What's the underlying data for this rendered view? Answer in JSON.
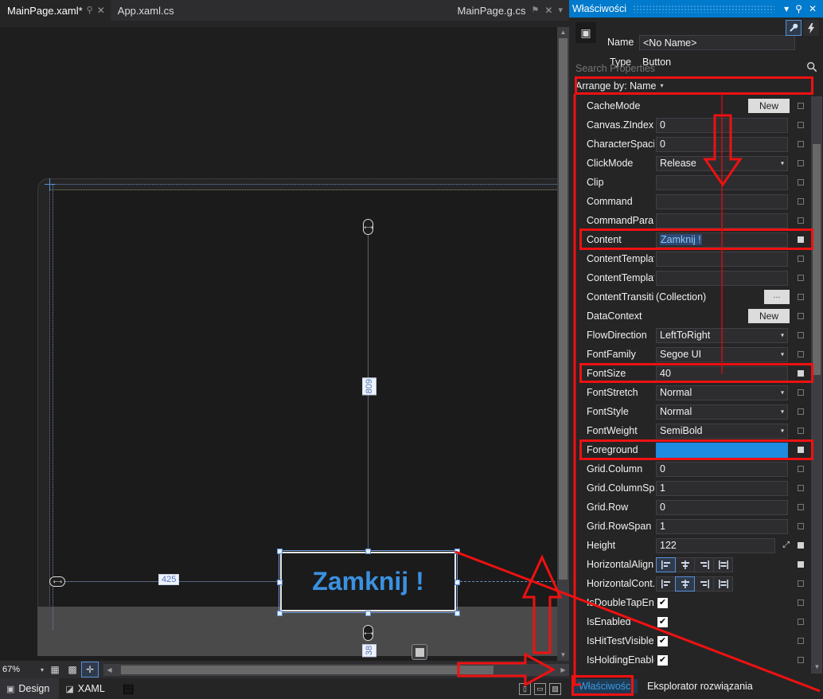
{
  "editor": {
    "tabs": [
      {
        "label": "MainPage.xaml*",
        "active": true,
        "pin": "⚲",
        "close": "✕"
      },
      {
        "label": "App.xaml.cs",
        "active": false,
        "pin": "",
        "close": ""
      }
    ],
    "right_tab": {
      "label": "MainPage.g.cs",
      "pin": "⚑",
      "close": "✕",
      "menu": "▾"
    }
  },
  "designer": {
    "button_text": "Zamknij !",
    "width_measure": "425",
    "height_measure": "809",
    "button_height_measure": "38",
    "measure_cap_glyph": "⟷",
    "zoom_level": "67%",
    "zoom_caret": "▾",
    "toolbar_icons": [
      {
        "name": "grid-icon",
        "glyph": "▦",
        "selected": false
      },
      {
        "name": "snap-grid-icon",
        "glyph": "▩",
        "selected": false
      },
      {
        "name": "snap-to-guides-icon",
        "glyph": "✛",
        "selected": true
      }
    ],
    "scroll_left_arrow": "◀",
    "scroll_right_arrow": "▶",
    "scroll_up_arrow": "▲",
    "scroll_down_arrow": "▼"
  },
  "designer_footer": {
    "tabs": [
      {
        "label": "Design",
        "icon": "▣",
        "active": true
      },
      {
        "label": "XAML",
        "icon": "◪",
        "active": false
      }
    ],
    "extra_icon": "▤",
    "split_buttons": [
      {
        "name": "vertical-split-button",
        "glyph": "▯"
      },
      {
        "name": "horizontal-split-button",
        "glyph": "▭"
      },
      {
        "name": "design-view-button",
        "glyph": "▨"
      }
    ]
  },
  "properties": {
    "title": "Właściwości",
    "title_controls": {
      "menu": "▾",
      "pin": "⚲",
      "close": "✕"
    },
    "object_icon": "▣",
    "name_label": "Name",
    "name_value": "<No Name>",
    "type_label": "Type",
    "type_value": "Button",
    "wrench_icon": "🔧",
    "events_icon": "⚡",
    "search_placeholder": "Search Properties",
    "search_icon": "🔍",
    "arrange_by": "Arrange by: Name",
    "rows": [
      {
        "name": "CacheMode",
        "kind": "new",
        "value": "",
        "marker": "empty"
      },
      {
        "name": "Canvas.ZIndex",
        "kind": "text",
        "value": "0",
        "marker": "empty"
      },
      {
        "name": "CharacterSpacing",
        "kind": "text",
        "value": "0",
        "marker": "empty"
      },
      {
        "name": "ClickMode",
        "kind": "dropdown",
        "value": "Release",
        "marker": "empty"
      },
      {
        "name": "Clip",
        "kind": "text",
        "value": "",
        "marker": "empty"
      },
      {
        "name": "Command",
        "kind": "text",
        "value": "",
        "marker": "empty"
      },
      {
        "name": "CommandPara...",
        "kind": "text",
        "value": "",
        "marker": "empty"
      },
      {
        "name": "Content",
        "kind": "selected-text",
        "value": "Zamknij !",
        "marker": "filled"
      },
      {
        "name": "ContentTemplate",
        "kind": "text",
        "value": "",
        "marker": "empty"
      },
      {
        "name": "ContentTemplat...",
        "kind": "text",
        "value": "",
        "marker": "empty"
      },
      {
        "name": "ContentTransiti...",
        "kind": "collection",
        "value": "(Collection)",
        "marker": "empty"
      },
      {
        "name": "DataContext",
        "kind": "new",
        "value": "",
        "marker": "empty"
      },
      {
        "name": "FlowDirection",
        "kind": "dropdown",
        "value": "LeftToRight",
        "marker": "empty"
      },
      {
        "name": "FontFamily",
        "kind": "dropdown",
        "value": "Segoe UI",
        "marker": "empty"
      },
      {
        "name": "FontSize",
        "kind": "text",
        "value": "40",
        "marker": "filled"
      },
      {
        "name": "FontStretch",
        "kind": "dropdown",
        "value": "Normal",
        "marker": "empty"
      },
      {
        "name": "FontStyle",
        "kind": "dropdown",
        "value": "Normal",
        "marker": "empty"
      },
      {
        "name": "FontWeight",
        "kind": "dropdown",
        "value": "SemiBold",
        "marker": "empty"
      },
      {
        "name": "Foreground",
        "kind": "color",
        "value": "",
        "marker": "filled"
      },
      {
        "name": "Grid.Column",
        "kind": "text",
        "value": "0",
        "marker": "empty"
      },
      {
        "name": "Grid.ColumnSpan",
        "kind": "text",
        "value": "1",
        "marker": "empty"
      },
      {
        "name": "Grid.Row",
        "kind": "text",
        "value": "0",
        "marker": "empty"
      },
      {
        "name": "Grid.RowSpan",
        "kind": "text",
        "value": "1",
        "marker": "empty"
      },
      {
        "name": "Height",
        "kind": "height",
        "value": "122",
        "marker": "filled"
      },
      {
        "name": "HorizontalAlign...",
        "kind": "align",
        "value": "",
        "marker": "filled",
        "selected_index": 0
      },
      {
        "name": "HorizontalCont...",
        "kind": "align",
        "value": "",
        "marker": "empty",
        "selected_index": 1
      },
      {
        "name": "IsDoubleTapEna...",
        "kind": "check",
        "value": "✔",
        "marker": "empty"
      },
      {
        "name": "IsEnabled",
        "kind": "check",
        "value": "✔",
        "marker": "empty"
      },
      {
        "name": "IsHitTestVisible",
        "kind": "check",
        "value": "✔",
        "marker": "empty"
      },
      {
        "name": "IsHoldingEnabled",
        "kind": "check",
        "value": "✔",
        "marker": "empty"
      }
    ],
    "new_button_label": "New",
    "ellipsis_button_label": "...",
    "foreground_color": "#1e8ae0",
    "align_glyphs": [
      "⊨",
      "⊹",
      "⊣",
      "⊫"
    ],
    "height_auto_icon": "⤢"
  },
  "properties_footer": {
    "tabs": [
      {
        "label": "Właściwości",
        "active": true
      },
      {
        "label": "Eksplorator rozwiązania",
        "active": false
      }
    ]
  },
  "annotations": {
    "highlight_color": "#ee1111"
  }
}
